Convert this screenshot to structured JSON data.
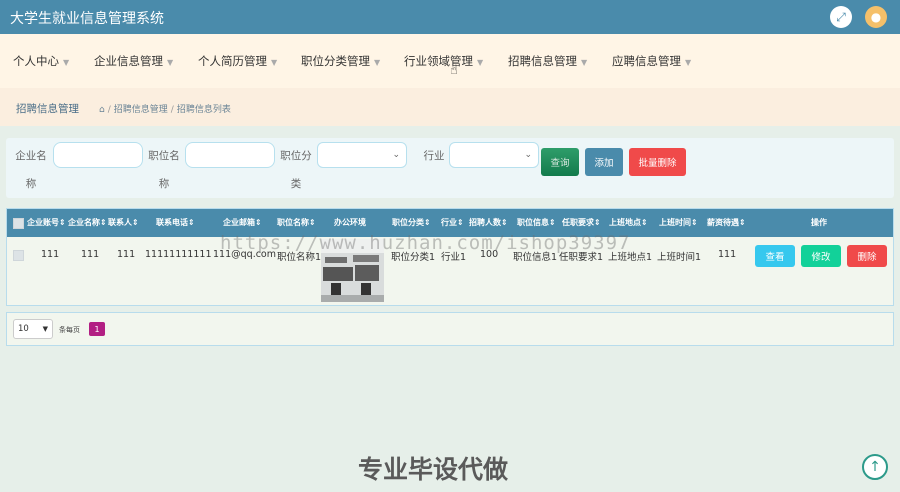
{
  "app": {
    "title": "大学生就业信息管理系统",
    "fullscreen_icon": "expand-arrows",
    "avatar_icon": "user"
  },
  "nav": [
    {
      "label": "个人中心"
    },
    {
      "label": "企业信息管理"
    },
    {
      "label": "个人简历管理"
    },
    {
      "label": "职位分类管理"
    },
    {
      "label": "行业领域管理"
    },
    {
      "label": "招聘信息管理"
    },
    {
      "label": "应聘信息管理"
    }
  ],
  "breadcrumb": {
    "title": "招聘信息管理",
    "home_icon": "⌂",
    "path1": "招聘信息管理",
    "path2": "招聘信息列表",
    "sep": "/"
  },
  "search": {
    "label_company": "企业名称",
    "label_position": "职位名称",
    "label_category": "职位分类",
    "label_industry": "行业",
    "btn_search": "查询",
    "btn_add": "添加",
    "btn_batch_delete": "批量删除"
  },
  "table": {
    "headers": [
      "企业账号",
      "企业名称",
      "联系人",
      "联系电话",
      "企业邮箱",
      "职位名称",
      "办公环境",
      "职位分类",
      "行业",
      "招聘人数",
      "职位信息",
      "任职要求",
      "上班地点",
      "上班时间",
      "薪资待遇",
      "操作"
    ],
    "row": {
      "account": "111",
      "company": "111",
      "contact": "111",
      "phone": "11111111111",
      "email": "111@qq.com",
      "position": "职位名称1",
      "category": "职位分类1",
      "industry": "行业1",
      "count": "100",
      "info": "职位信息1",
      "requirement": "任职要求1",
      "location": "上班地点1",
      "worktime": "上班时间1",
      "salary": "111"
    },
    "actions": {
      "view": "查看",
      "edit": "修改",
      "delete": "删除"
    }
  },
  "pager": {
    "page_size": "10",
    "per_page_label": "条每页",
    "current_page": "1"
  },
  "watermark": {
    "url": "https://www.huzhan.com/ishop39397",
    "text": "专业毕设代做"
  },
  "colors": {
    "primary": "#4a8bab",
    "danger": "#f04a4a",
    "success": "#12d199",
    "info": "#36c8ee",
    "page_active": "#b21f83"
  }
}
